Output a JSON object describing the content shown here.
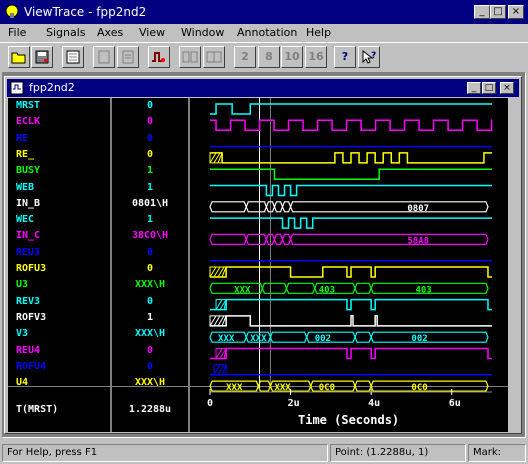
{
  "app": {
    "title": "ViewTrace - fpp2nd2",
    "minimize": "_",
    "maximize": "□",
    "close": "×"
  },
  "menu": [
    "File",
    "Signals",
    "Axes",
    "View",
    "Window",
    "Annotation",
    "Help"
  ],
  "toolbar": {
    "buttons": [
      "open",
      "save",
      "signals",
      "props-1",
      "props-2",
      "analyze",
      "group-1",
      "group-2"
    ],
    "radix": [
      "2",
      "8",
      "10",
      "16"
    ],
    "help": "?",
    "context_help": "?"
  },
  "doc": {
    "title": "fpp2nd2",
    "minimize": "_",
    "maximize": "□",
    "close": "×"
  },
  "signals": [
    {
      "name": "MRST",
      "value": "0",
      "color": "#00ffff"
    },
    {
      "name": "ECLK",
      "value": "0",
      "color": "#ff00ff"
    },
    {
      "name": "RE",
      "value": "0",
      "color": "#0000ff"
    },
    {
      "name": "RE_",
      "value": "0",
      "color": "#ffff00"
    },
    {
      "name": "BUSY",
      "value": "1",
      "color": "#00ff00"
    },
    {
      "name": "WEB",
      "value": "1",
      "color": "#00ffff"
    },
    {
      "name": "IN_B",
      "value": "0801\\H",
      "color": "#ffffff"
    },
    {
      "name": "WEC",
      "value": "1",
      "color": "#00ffff"
    },
    {
      "name": "IN_C",
      "value": "38C0\\H",
      "color": "#ff00ff"
    },
    {
      "name": "REU3",
      "value": "0",
      "color": "#0000ff"
    },
    {
      "name": "ROFU3",
      "value": "0",
      "color": "#ffff00"
    },
    {
      "name": "U3",
      "value": "XXX\\H",
      "color": "#00ff00"
    },
    {
      "name": "REV3",
      "value": "0",
      "color": "#00ffff"
    },
    {
      "name": "ROFV3",
      "value": "1",
      "color": "#ffffff"
    },
    {
      "name": "V3",
      "value": "XXX\\H",
      "color": "#00ffff"
    },
    {
      "name": "REU4",
      "value": "0",
      "color": "#ff00ff"
    },
    {
      "name": "ROFU4",
      "value": "0",
      "color": "#0000ff"
    },
    {
      "name": "U4",
      "value": "XXX\\H",
      "color": "#ffff00"
    }
  ],
  "bus_labels": {
    "IN_B": "0807",
    "IN_C": "58A8",
    "U3": [
      "XXX",
      "403",
      "403"
    ],
    "V3": [
      "XXX",
      "XXX",
      "002",
      "002"
    ],
    "U4": [
      "XXX",
      "XXX",
      "0C0",
      "0C0"
    ]
  },
  "measure": {
    "label": "T(MRST)",
    "value": "1.2288u"
  },
  "axis": {
    "ticks": [
      "0",
      "2u",
      "4u",
      "6u"
    ],
    "label": "Time (Seconds)"
  },
  "status": {
    "help": "For Help, press F1",
    "point": "Point: (1.2288u, 1)",
    "mark": "Mark:"
  }
}
